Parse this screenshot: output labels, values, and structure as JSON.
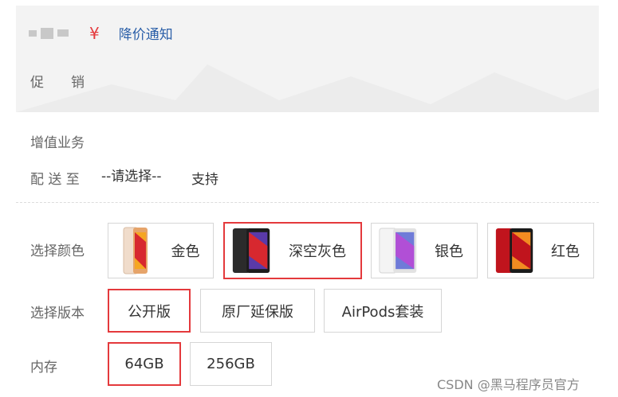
{
  "price": {
    "currency_symbol": "¥",
    "notify_link": "降价通知",
    "promo_label_chars": [
      "促",
      "销"
    ]
  },
  "fields": {
    "value_added_label": "增值业务",
    "delivery_label": "配 送 至",
    "delivery_select": "--请选择--",
    "delivery_support": "支持"
  },
  "color": {
    "label": "选择颜色",
    "options": [
      {
        "name": "金色",
        "swatch": "#e9c9b0",
        "selected": false
      },
      {
        "name": "深空灰色",
        "swatch": "#2b2b2b",
        "selected": true
      },
      {
        "name": "银色",
        "swatch": "#ececec",
        "selected": false
      },
      {
        "name": "红色",
        "swatch": "#c0141d",
        "selected": false
      }
    ]
  },
  "version": {
    "label": "选择版本",
    "options": [
      "公开版",
      "原厂延保版",
      "AirPods套装"
    ],
    "selected_index": 0
  },
  "memory": {
    "label": "内存",
    "options": [
      "64GB",
      "256GB"
    ],
    "selected_index": 0
  },
  "watermark": "CSDN @黑马程序员官方",
  "colors": {
    "accent": "#e4393c",
    "link": "#2b5fa8",
    "panel": "#f3f3f3",
    "border": "#d6d6d6"
  }
}
